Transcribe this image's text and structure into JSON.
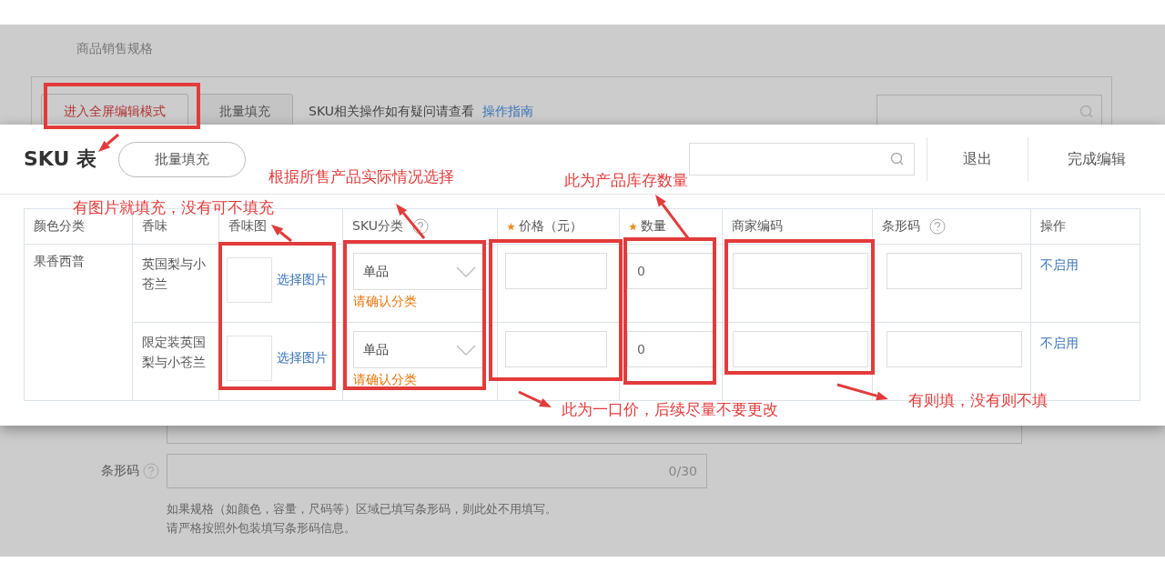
{
  "page": {
    "section_title": "商品销售规格",
    "toolbar": {
      "fullscreen_button": "进入全屏编辑模式",
      "bulk_fill_button": "批量填充",
      "help_text": "SKU相关操作如有疑问请查看",
      "help_link": "操作指南"
    },
    "barcode_field": {
      "label": "条形码",
      "counter": "0/30"
    },
    "hints": [
      "如果规格（如颜色，容量，尺码等）区域已填写条形码，则此处不用填写。",
      "请严格按照外包装填写条形码信息。"
    ]
  },
  "sku_panel": {
    "title": "SKU 表",
    "bulk_fill_button": "批量填充",
    "exit_button": "退出",
    "done_button": "完成编辑",
    "table": {
      "columns": [
        {
          "label": "颜色分类",
          "required": false,
          "help": false
        },
        {
          "label": "香味",
          "required": false,
          "help": false
        },
        {
          "label": "香味图",
          "required": false,
          "help": false
        },
        {
          "label": "SKU分类",
          "required": false,
          "help": true
        },
        {
          "label": "价格（元）",
          "required": true,
          "help": false
        },
        {
          "label": "数量",
          "required": true,
          "help": false
        },
        {
          "label": "商家编码",
          "required": false,
          "help": false
        },
        {
          "label": "条形码",
          "required": false,
          "help": true
        },
        {
          "label": "操作",
          "required": false,
          "help": false
        }
      ],
      "group": "果香西普",
      "rows": [
        {
          "flavor": "英国梨与小苍兰",
          "image_link": "选择图片",
          "sku_type": "单品",
          "warning": "请确认分类",
          "quantity": "0",
          "action": "不启用"
        },
        {
          "flavor": "限定装英国梨与小苍兰",
          "image_link": "选择图片",
          "sku_type": "单品",
          "warning": "请确认分类",
          "quantity": "0",
          "action": "不启用"
        }
      ]
    }
  },
  "annotations": [
    {
      "text": "有图片就填充，没有可不填充"
    },
    {
      "text": "根据所售产品实际情况选择"
    },
    {
      "text": "此为产品库存数量"
    },
    {
      "text": "此为一口价，后续尽量不要更改"
    },
    {
      "text": "有则填，没有则不填"
    }
  ]
}
